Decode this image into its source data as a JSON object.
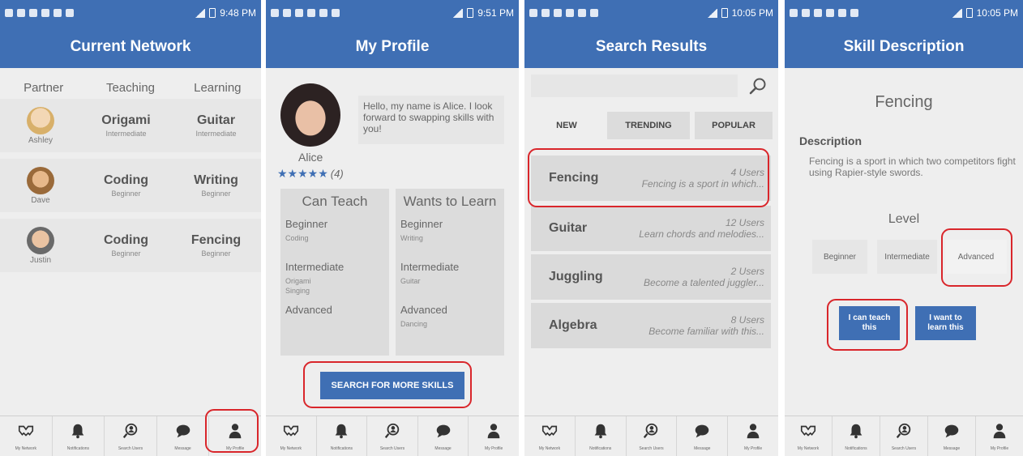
{
  "colors": {
    "primary": "#3f6fb4",
    "highlight": "#d9262b",
    "background": "#eeeeee"
  },
  "panels": {
    "network": {
      "status_time": "9:48 PM",
      "title": "Current Network",
      "headers": [
        "Partner",
        "Teaching",
        "Learning"
      ],
      "rows": [
        {
          "partner": "Ashley",
          "teaching": "Origami",
          "teaching_level": "Intermediate",
          "learning": "Guitar",
          "learning_level": "Intermediate"
        },
        {
          "partner": "Dave",
          "teaching": "Coding",
          "teaching_level": "Beginner",
          "learning": "Writing",
          "learning_level": "Beginner"
        },
        {
          "partner": "Justin",
          "teaching": "Coding",
          "teaching_level": "Beginner",
          "learning": "Fencing",
          "learning_level": "Beginner"
        }
      ]
    },
    "profile": {
      "status_time": "9:51 PM",
      "title": "My Profile",
      "bio": "Hello, my name is Alice. I look forward to swapping skills with you!",
      "name": "Alice",
      "stars": "★★★★★",
      "rating_count": "(4)",
      "rating": 4.5,
      "can_teach": {
        "title": "Can Teach",
        "beginner_label": "Beginner",
        "beginner_items": "Coding",
        "intermediate_label": "Intermediate",
        "intermediate_items": "Origami\nSinging",
        "advanced_label": "Advanced",
        "advanced_items": ""
      },
      "wants_to_learn": {
        "title": "Wants to Learn",
        "beginner_label": "Beginner",
        "beginner_items": "Writing",
        "intermediate_label": "Intermediate",
        "intermediate_items": "Guitar",
        "advanced_label": "Advanced",
        "advanced_items": "Dancing"
      },
      "search_button": "SEARCH FOR MORE SKILLS"
    },
    "search": {
      "status_time": "10:05 PM",
      "title": "Search Results",
      "search_value": "",
      "tabs": [
        "NEW",
        "TRENDING",
        "POPULAR"
      ],
      "results": [
        {
          "name": "Fencing",
          "users": "4 Users",
          "desc": "Fencing is a sport in which..."
        },
        {
          "name": "Guitar",
          "users": "12 Users",
          "desc": "Learn chords and melodies..."
        },
        {
          "name": "Juggling",
          "users": "2 Users",
          "desc": "Become a talented juggler..."
        },
        {
          "name": "Algebra",
          "users": "8 Users",
          "desc": "Become familiar with this..."
        }
      ]
    },
    "skill": {
      "status_time": "10:05 PM",
      "title": "Skill Description",
      "skill_name": "Fencing",
      "description_label": "Description",
      "description": "Fencing is a sport in which two competitors fight using Rapier-style swords.",
      "level_label": "Level",
      "levels": [
        "Beginner",
        "Intermediate",
        "Advanced"
      ],
      "teach_button": "I can teach this",
      "learn_button": "I want to learn this"
    }
  },
  "nav": {
    "items": [
      {
        "label": "My Network",
        "icon": "network-icon"
      },
      {
        "label": "Notifications",
        "icon": "bell-icon"
      },
      {
        "label": "Search Users",
        "icon": "search-users-icon"
      },
      {
        "label": "Message",
        "icon": "message-icon"
      },
      {
        "label": "My Profile",
        "icon": "profile-icon"
      }
    ]
  }
}
